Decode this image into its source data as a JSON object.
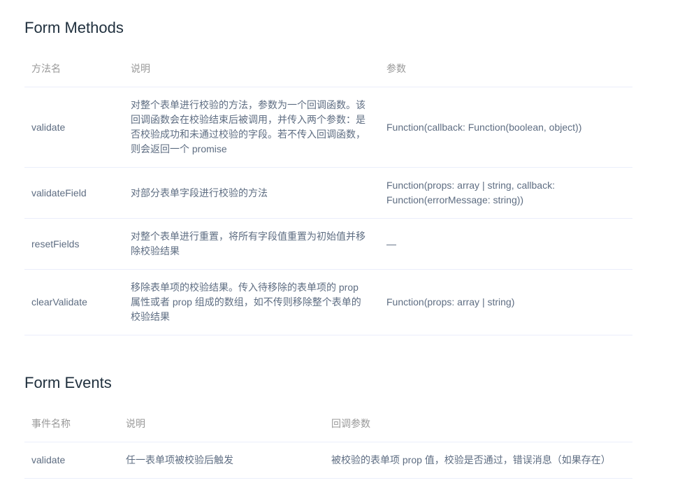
{
  "methods": {
    "title": "Form Methods",
    "headers": [
      "方法名",
      "说明",
      "参数"
    ],
    "rows": [
      {
        "name": "validate",
        "description": "对整个表单进行校验的方法，参数为一个回调函数。该回调函数会在校验结束后被调用，并传入两个参数：是否校验成功和未通过校验的字段。若不传入回调函数，则会返回一个 promise",
        "params": "Function(callback: Function(boolean, object))"
      },
      {
        "name": "validateField",
        "description": "对部分表单字段进行校验的方法",
        "params": "Function(props: array | string, callback: Function(errorMessage: string))"
      },
      {
        "name": "resetFields",
        "description": "对整个表单进行重置，将所有字段值重置为初始值并移除校验结果",
        "params": "—"
      },
      {
        "name": "clearValidate",
        "description": "移除表单项的校验结果。传入待移除的表单项的 prop 属性或者 prop 组成的数组，如不传则移除整个表单的校验结果",
        "params": "Function(props: array | string)"
      }
    ]
  },
  "events": {
    "title": "Form Events",
    "headers": [
      "事件名称",
      "说明",
      "回调参数"
    ],
    "rows": [
      {
        "name": "validate",
        "description": "任一表单项被校验后触发",
        "params": "被校验的表单项 prop 值，校验是否通过，错误消息（如果存在）"
      }
    ]
  }
}
